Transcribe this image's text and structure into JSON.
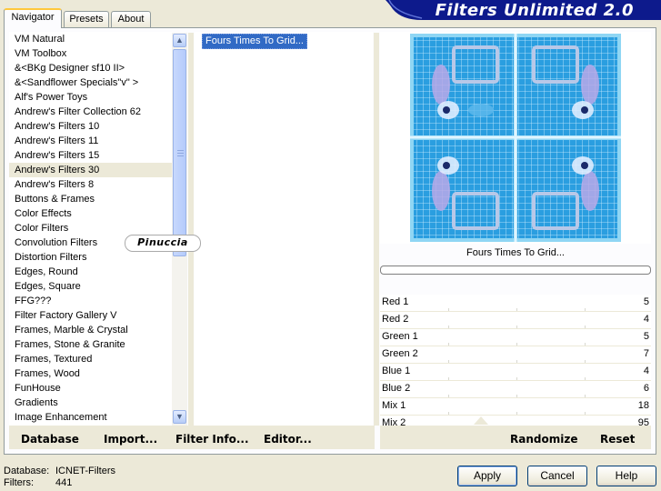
{
  "app_title": "Filters Unlimited 2.0",
  "tabs": [
    "Navigator",
    "Presets",
    "About"
  ],
  "categories": [
    "VM Natural",
    "VM Toolbox",
    "&<BKg Designer sf10 II>",
    "&<Sandflower Specials\"v\" >",
    "Alf's Power Toys",
    "Andrew's Filter Collection 62",
    "Andrew's Filters 10",
    "Andrew's Filters 11",
    "Andrew's Filters 15",
    "Andrew's Filters 30",
    "Andrew's Filters 8",
    "Buttons & Frames",
    "Color Effects",
    "Color Filters",
    "Convolution Filters",
    "Distortion Filters",
    "Edges, Round",
    "Edges, Square",
    "FFG???",
    "Filter Factory Gallery V",
    "Frames, Marble & Crystal",
    "Frames, Stone & Granite",
    "Frames, Textured",
    "Frames, Wood",
    "FunHouse",
    "Gradients",
    "Image Enhancement"
  ],
  "selected_category_index": 9,
  "filters": [
    "Fours Times To Grid..."
  ],
  "current_filter_name": "Fours Times To Grid...",
  "progress": 0,
  "params": [
    {
      "label": "Red 1",
      "value": "5"
    },
    {
      "label": "Red 2",
      "value": "4"
    },
    {
      "label": "Green 1",
      "value": "5"
    },
    {
      "label": "Green 2",
      "value": "7"
    },
    {
      "label": "Blue 1",
      "value": "4"
    },
    {
      "label": "Blue 2",
      "value": "6"
    },
    {
      "label": "Mix 1",
      "value": "18"
    },
    {
      "label": "Mix 2",
      "value": "95"
    }
  ],
  "bottom_buttons": {
    "database": "Database",
    "import": "Import...",
    "filter_info": "Filter Info...",
    "editor": "Editor...",
    "randomize": "Randomize",
    "reset": "Reset"
  },
  "footer": {
    "database_label": "Database:",
    "database_value": "ICNET-Filters",
    "filters_label": "Filters:",
    "filters_value": "441"
  },
  "dialog_buttons": {
    "apply": "Apply",
    "cancel": "Cancel",
    "help": "Help"
  },
  "watermark": "Pinuccia",
  "colors": {
    "banner": "#0d1a8c",
    "selection": "#316ac5",
    "dialog_bg": "#ece9d8",
    "preview_blue": "#2fa0e0"
  }
}
